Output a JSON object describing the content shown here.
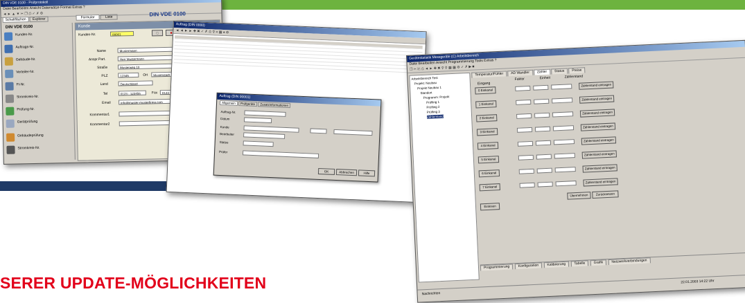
{
  "headline": "SERER UPDATE-MÖGLICHKEITEN",
  "colors": {
    "accent_green": "#6db33f",
    "headline_red": "#e2001a",
    "band_navy": "#1f3a66"
  },
  "win1": {
    "title": "DIN VDE 0100 - Prüfprotokoll",
    "menu": "Datei  Bearbeiten  Ansicht  Datensätze  Format  Extras  ?",
    "tabs": [
      "Schaltflächen",
      "Explorer"
    ],
    "header_tabs": [
      "Formular",
      "Liste"
    ],
    "norm": "DIN VDE 0100",
    "side_title": "DIN VDE 0100",
    "side_items": [
      "Kunden-Nr.",
      "Auftrags-Nr.",
      "Gebäude-Nr.",
      "Verteiler-Nr.",
      "FI-Nr.",
      "Stromkreis-Nr.",
      "Prüfung-Nr.",
      "Gerätprüfung",
      "Gebäudeprüfung",
      "Stromkreis-Nr."
    ],
    "panel_title": "Kunde",
    "form_labels": [
      "Kunden-Nr.",
      "Name",
      "Anspr.Part.",
      "Straße",
      "PLZ",
      "Ort",
      "Land",
      "Tel",
      "Fax",
      "Email",
      "Kommentar1",
      "Kommentar2"
    ],
    "form_values": [
      "00001",
      "Mustermann",
      "Herr Mustermann",
      "Musterweg 10",
      "12345",
      "Musterstadt",
      "Deutschland",
      "0123 - 123456",
      "0123 - 1234",
      "info@muster-musterfirma.com",
      "",
      ""
    ]
  },
  "win2": {
    "title": "Auftrag (DIN 0000)",
    "dialog_title": "Auftrag (DIN 00001)",
    "dialog_tabs": [
      "Allgemein",
      "Prüfgeräte",
      "Zusatzinformationen"
    ],
    "fields": [
      "Auftrag-Nr.",
      "Datum",
      "Kunde",
      "Bearbeiter",
      "Status",
      "Prüfer"
    ],
    "buttons": [
      "OK",
      "Abbrechen",
      "Hilfe"
    ]
  },
  "win3": {
    "title": "Gerätestatistik Messgeräte (C) Arbeitsbereich",
    "menu": "Datei  Bearbeiten  Ansicht  Programmierung  Tools  Extras  ?",
    "tree": [
      "Arbeitsbereich Test",
      "Projekt: Neubau",
      "Projekt Neubau 1",
      "Standort",
      "Programm: Projekt",
      "Prüfling 1",
      "Prüfling 2",
      "Prüfling 3",
      "Zählerstand"
    ],
    "tabs": [
      "Temperatur/Fühler",
      "AD Wandler",
      "Zähler",
      "Status",
      "Preise"
    ],
    "headers": [
      "Eingang",
      "Faktor",
      "Einheit",
      "Zählerstand"
    ],
    "rows": [
      "0 Einkanal",
      "1 Einkanal",
      "2 Einkanal",
      "3 Einkanal",
      "4 Einkanal",
      "5 Einkanal",
      "6 Einkanal",
      "7 Einkanal"
    ],
    "row_button": "Zählerstand eintragen",
    "bottom_buttons": [
      "Übernehmen",
      "Zurücksetzen"
    ],
    "extra_button": "Einlesen",
    "lower_tabs": [
      "Programmierung",
      "Konfiguration",
      "Kalibrierung",
      "Tabelle",
      "Grafik",
      "Netzwerkverbindungen"
    ],
    "status_left": "Nachrichten",
    "status_right": "22.01.2003 14:22 Uhr"
  }
}
